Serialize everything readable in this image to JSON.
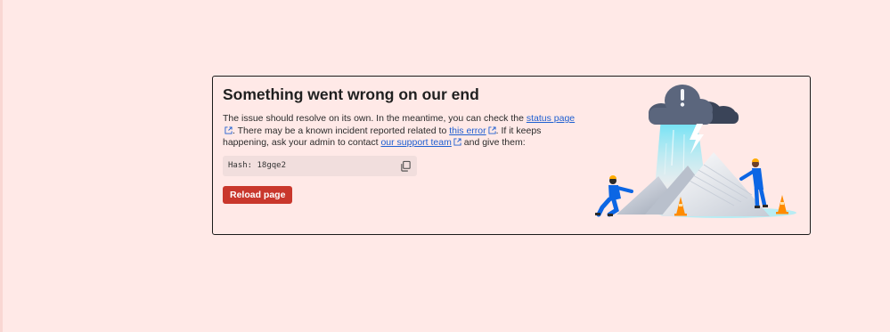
{
  "error": {
    "title": "Something went wrong on our end",
    "message_part1": "The issue should resolve on its own. In the meantime, you can check the ",
    "status_page_link": "status page",
    "message_part2": ". There may be a known incident reported related to ",
    "this_error_link": "this error",
    "message_part3": ". If it keeps happening, ask your admin to contact ",
    "support_team_link": "our support team",
    "message_part4": " and give them:",
    "hash_text": "Hash: 18gqe2",
    "reload_label": "Reload page"
  },
  "icons": {
    "external_link": "external-link-icon",
    "copy": "copy-icon",
    "illustration": "storm-cloud-illustration"
  },
  "colors": {
    "background": "#ffe9e7",
    "primary_button": "#c9372c",
    "link": "#1f5fd1",
    "hash_box": "#f1dedd"
  }
}
